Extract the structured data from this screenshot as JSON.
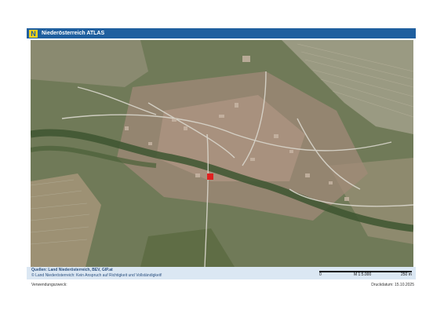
{
  "header": {
    "logo_glyph": "N",
    "title": "Niederösterreich ATLAS"
  },
  "map": {
    "marker_color": "#e02020",
    "description_icons": [
      "aerial-photo",
      "location-marker"
    ]
  },
  "footer": {
    "sources_line": "Quellen: Land Niederösterreich, BEV, GIP.at",
    "disclaimer_line": "© Land Niederösterreich: Kein Anspruch auf Richtigkeit und Vollständigkeit!",
    "scale": {
      "left_label": "0",
      "ratio_label": "M 1:5.000",
      "right_label": "250 m"
    },
    "purpose_label": "Verwendungszweck:",
    "print_date": "Druckdatum: 15.10.2025"
  }
}
